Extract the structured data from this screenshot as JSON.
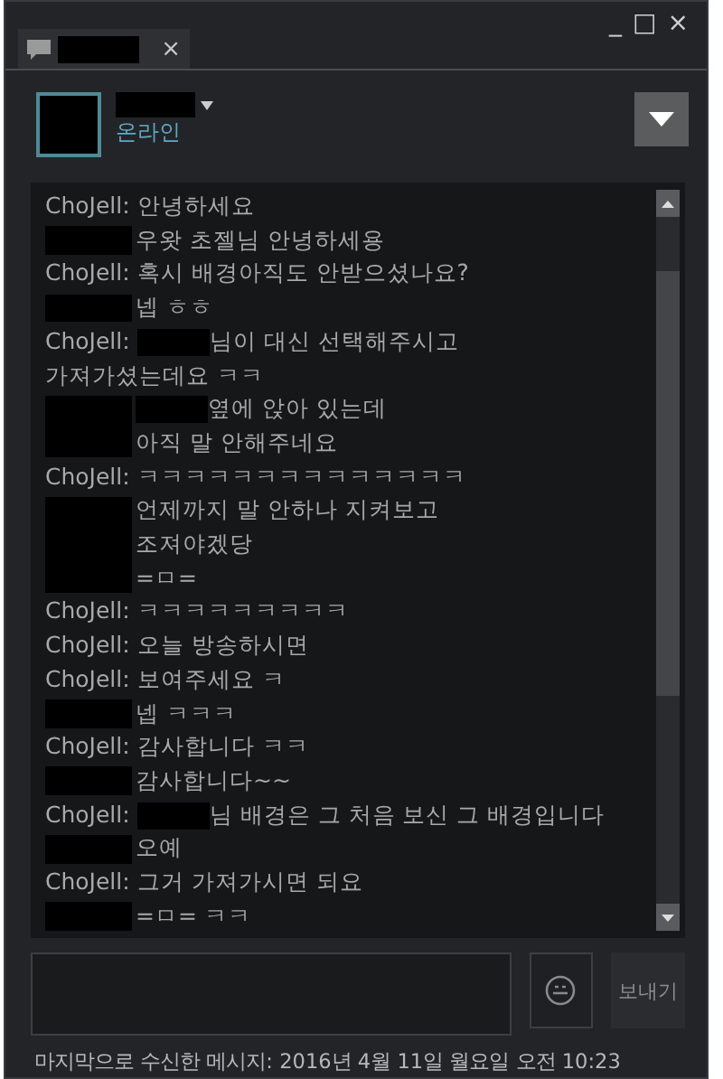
{
  "tab": {
    "close": "×"
  },
  "window_controls": [
    "_",
    "□",
    "×"
  ],
  "friend": {
    "status": "온라인"
  },
  "messages": [
    {
      "sender": {
        "kind": "name",
        "text": "ChoJell:"
      },
      "lines": [
        [
          {
            "kind": "text",
            "text": "안녕하세요"
          }
        ]
      ]
    },
    {
      "sender": {
        "kind": "redacted"
      },
      "lines": [
        [
          {
            "kind": "text",
            "text": "우왓 초젤님 안녕하세용"
          }
        ]
      ]
    },
    {
      "sender": {
        "kind": "name",
        "text": "ChoJell:"
      },
      "lines": [
        [
          {
            "kind": "text",
            "text": "혹시 배경아직도 안받으셨나요?"
          }
        ]
      ]
    },
    {
      "sender": {
        "kind": "redacted"
      },
      "lines": [
        [
          {
            "kind": "text",
            "text": "넵 ㅎㅎ"
          }
        ]
      ]
    },
    {
      "sender": {
        "kind": "name",
        "text": "ChoJell:"
      },
      "lines": [
        [
          {
            "kind": "redacted"
          },
          {
            "kind": "text",
            "text": "님이 대신 선택해주시고"
          }
        ],
        [
          {
            "kind": "text",
            "text": "가져가셨는데요 ㅋㅋ"
          }
        ]
      ]
    },
    {
      "sender": {
        "kind": "redacted"
      },
      "lines": [
        [
          {
            "kind": "redacted"
          },
          {
            "kind": "text",
            "text": "옆에 앉아 있는데"
          }
        ],
        [
          {
            "kind": "text",
            "text": "아직 말 안해주네요"
          }
        ]
      ]
    },
    {
      "sender": {
        "kind": "name",
        "text": "ChoJell:"
      },
      "lines": [
        [
          {
            "kind": "text",
            "text": "ㅋㅋㅋㅋㅋㅋㅋㅋㅋㅋㅋㅋㅋㅋ"
          }
        ]
      ]
    },
    {
      "sender": {
        "kind": "redacted"
      },
      "lines": [
        [
          {
            "kind": "text",
            "text": "언제까지 말 안하나 지켜보고"
          }
        ],
        [
          {
            "kind": "text",
            "text": "조져야겠당"
          }
        ],
        [
          {
            "kind": "text",
            "text": "=ㅁ="
          }
        ]
      ]
    },
    {
      "sender": {
        "kind": "name",
        "text": "ChoJell:"
      },
      "lines": [
        [
          {
            "kind": "text",
            "text": "ㅋㅋㅋㅋㅋㅋㅋㅋㅋ"
          }
        ]
      ]
    },
    {
      "sender": {
        "kind": "name",
        "text": "ChoJell:"
      },
      "lines": [
        [
          {
            "kind": "text",
            "text": "오늘 방송하시면"
          }
        ]
      ]
    },
    {
      "sender": {
        "kind": "name",
        "text": "ChoJell:"
      },
      "lines": [
        [
          {
            "kind": "text",
            "text": "보여주세요 ㅋ"
          }
        ]
      ]
    },
    {
      "sender": {
        "kind": "redacted"
      },
      "lines": [
        [
          {
            "kind": "text",
            "text": "넵 ㅋㅋㅋ"
          }
        ]
      ]
    },
    {
      "sender": {
        "kind": "name",
        "text": "ChoJell:"
      },
      "lines": [
        [
          {
            "kind": "text",
            "text": "감사합니다 ㅋㅋ"
          }
        ]
      ]
    },
    {
      "sender": {
        "kind": "redacted"
      },
      "lines": [
        [
          {
            "kind": "text",
            "text": "감사합니다~~"
          }
        ]
      ]
    },
    {
      "sender": {
        "kind": "name",
        "text": "ChoJell:"
      },
      "lines": [
        [
          {
            "kind": "redacted"
          },
          {
            "kind": "text",
            "text": "님 배경은 그 처음 보신 그 배경입니다"
          }
        ]
      ]
    },
    {
      "sender": {
        "kind": "redacted"
      },
      "lines": [
        [
          {
            "kind": "text",
            "text": "오예"
          }
        ]
      ]
    },
    {
      "sender": {
        "kind": "name",
        "text": "ChoJell:"
      },
      "lines": [
        [
          {
            "kind": "text",
            "text": "그거 가져가시면 되요"
          }
        ]
      ]
    },
    {
      "sender": {
        "kind": "redacted"
      },
      "lines": [
        [
          {
            "kind": "text",
            "text": "=ㅁ= ㅋㅋ"
          }
        ]
      ]
    }
  ],
  "send_button": "보내기",
  "status_bar": "마지막으로 수신한 메시지: 2016년 4월 11일 월요일 오전 10:23"
}
